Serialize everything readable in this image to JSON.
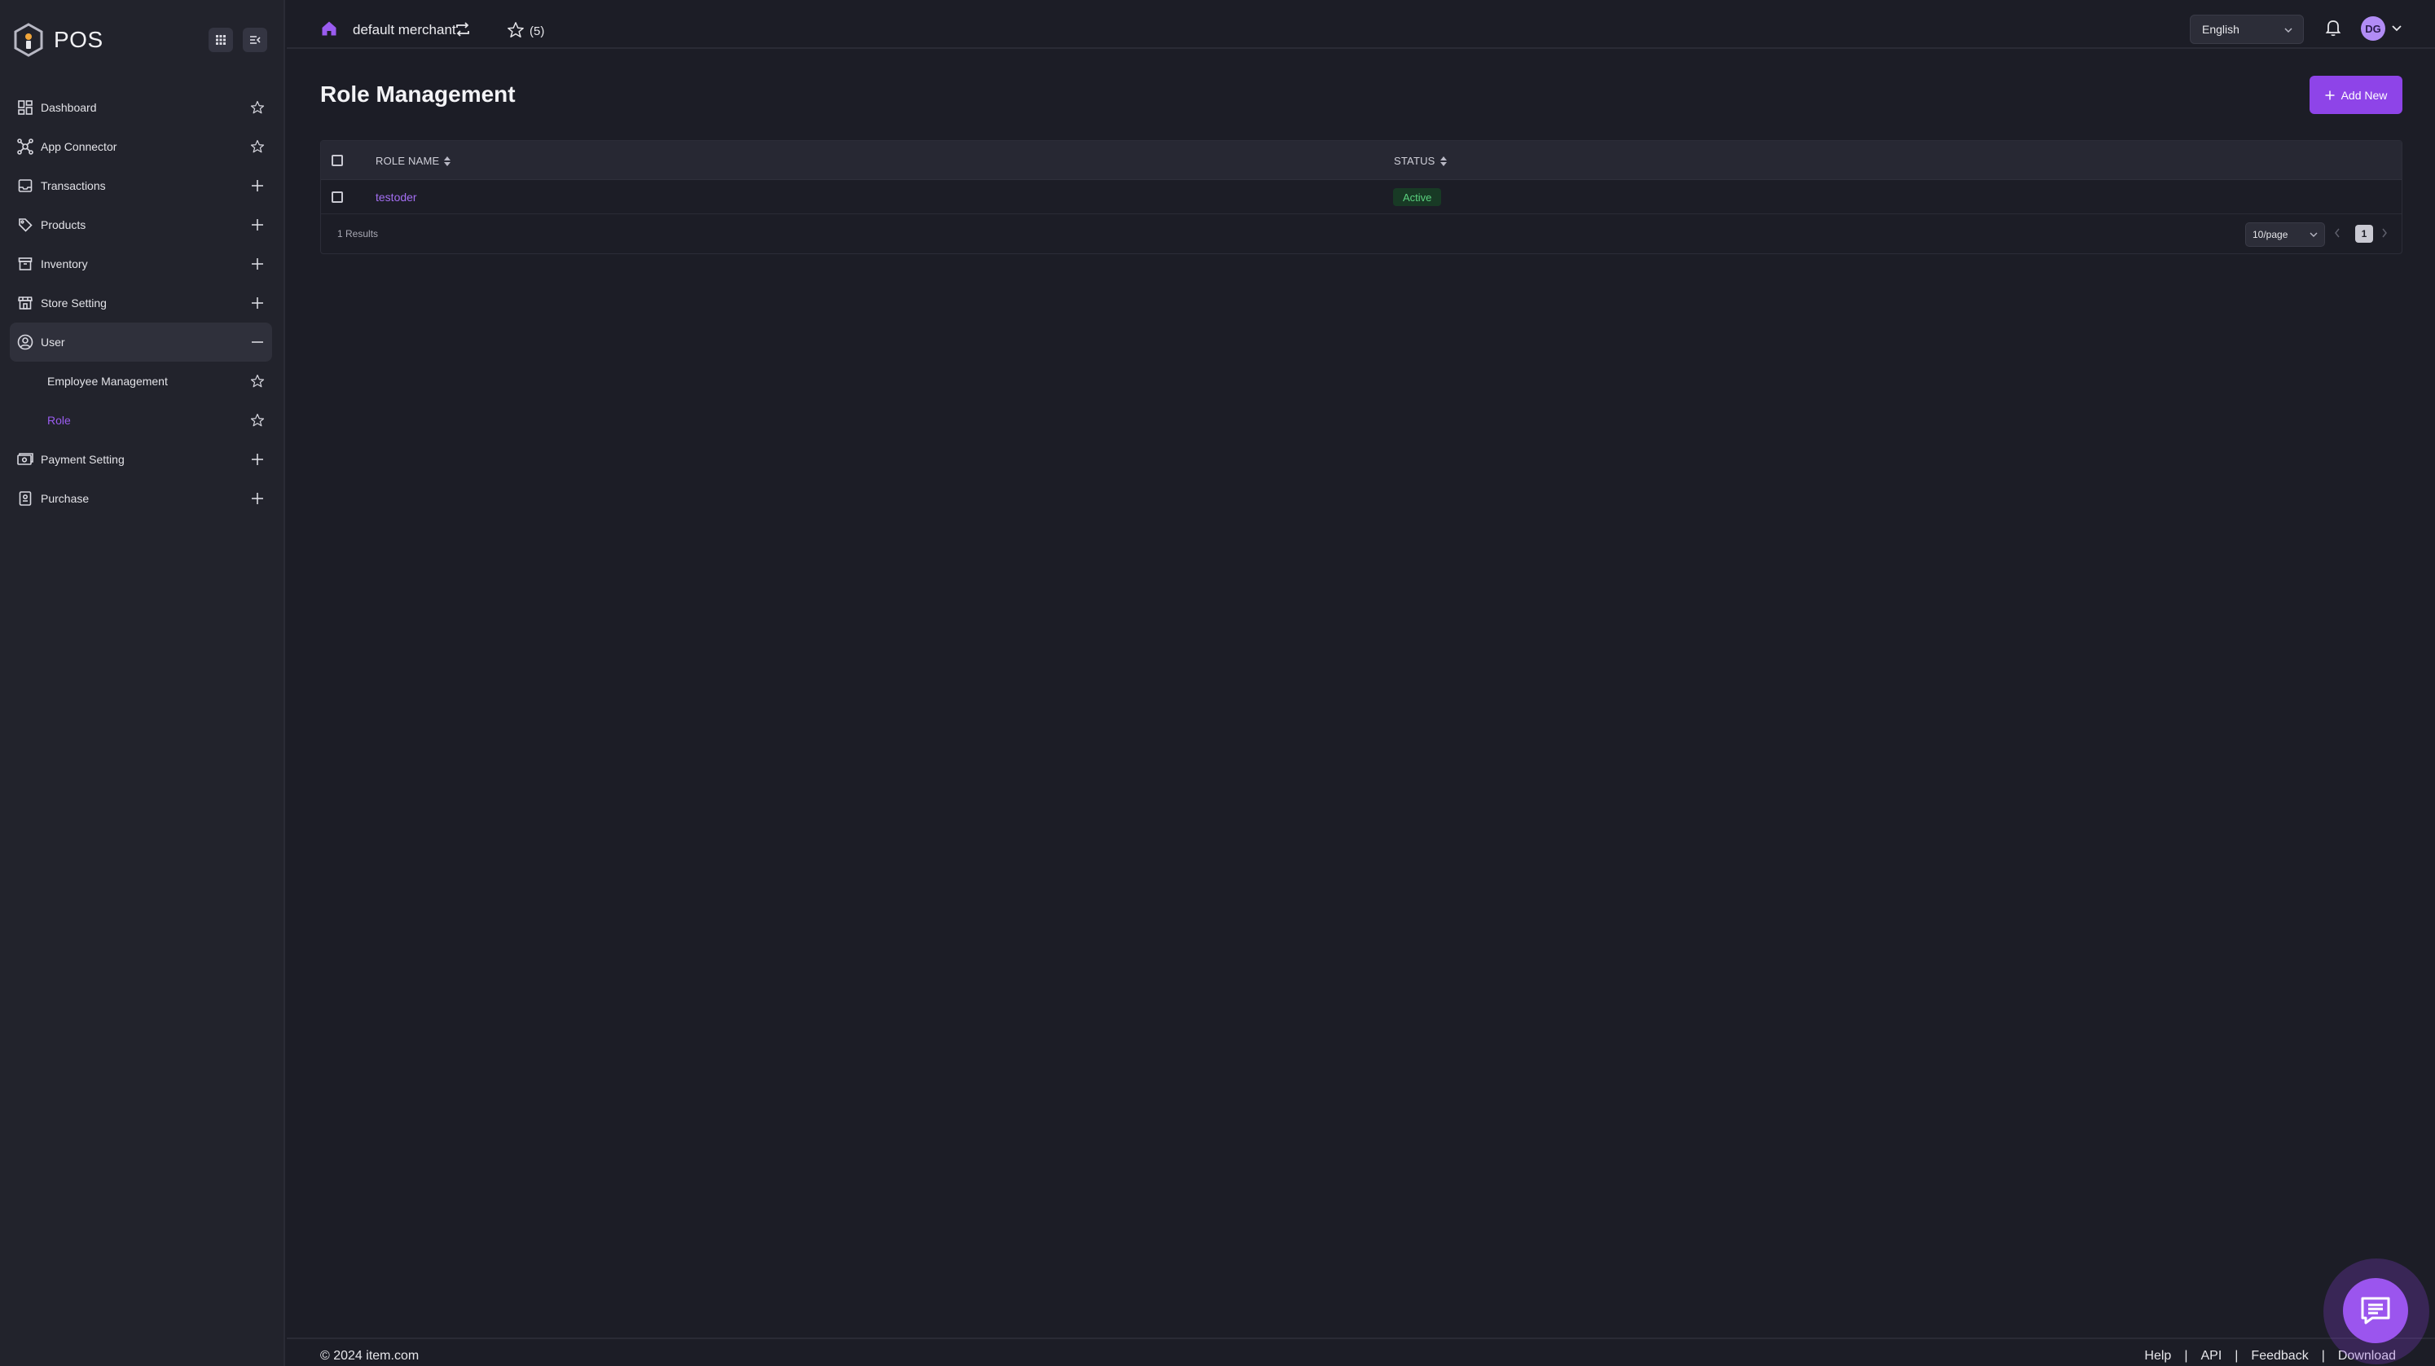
{
  "app": {
    "name": "POS"
  },
  "sidebar": {
    "items": [
      {
        "label": "Dashboard",
        "icon": "dashboard-icon",
        "action": "star"
      },
      {
        "label": "App Connector",
        "icon": "connector-icon",
        "action": "star"
      },
      {
        "label": "Transactions",
        "icon": "transactions-icon",
        "action": "plus"
      },
      {
        "label": "Products",
        "icon": "tag-icon",
        "action": "plus"
      },
      {
        "label": "Inventory",
        "icon": "archive-icon",
        "action": "plus"
      },
      {
        "label": "Store Setting",
        "icon": "store-icon",
        "action": "plus"
      },
      {
        "label": "User",
        "icon": "user-circle-icon",
        "action": "minus",
        "expanded": true,
        "children": [
          {
            "label": "Employee Management",
            "active": false
          },
          {
            "label": "Role",
            "active": true
          }
        ]
      },
      {
        "label": "Payment Setting",
        "icon": "payment-icon",
        "action": "plus"
      },
      {
        "label": "Purchase",
        "icon": "purchase-icon",
        "action": "plus"
      }
    ]
  },
  "topbar": {
    "merchant": "default merchant",
    "favorites_count": "(5)",
    "language": "English",
    "avatar_initials": "DG"
  },
  "page": {
    "title": "Role Management",
    "add_button": "Add New"
  },
  "table": {
    "columns": [
      "ROLE NAME",
      "STATUS"
    ],
    "rows": [
      {
        "role_name": "testoder",
        "status": "Active"
      }
    ],
    "results": "1 Results",
    "page_size": "10/page",
    "current_page": "1"
  },
  "footer": {
    "copyright": "© 2024 item.com",
    "links": [
      "Help",
      "API",
      "Feedback",
      "Download"
    ]
  },
  "colors": {
    "accent": "#8e44e8",
    "background": "#1c1d26",
    "sidebar": "#22232c",
    "status_active": "#5ad07e"
  }
}
